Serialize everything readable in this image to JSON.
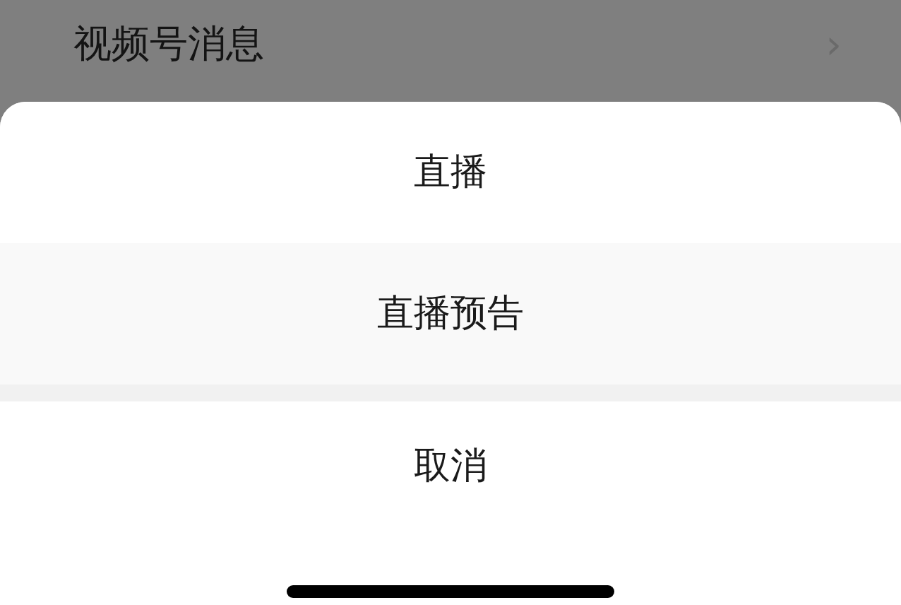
{
  "background_item": {
    "label": "视频号消息",
    "chevron": "›"
  },
  "action_sheet": {
    "options": [
      {
        "label": "直播"
      },
      {
        "label": "直播预告"
      }
    ],
    "cancel": "取消"
  }
}
